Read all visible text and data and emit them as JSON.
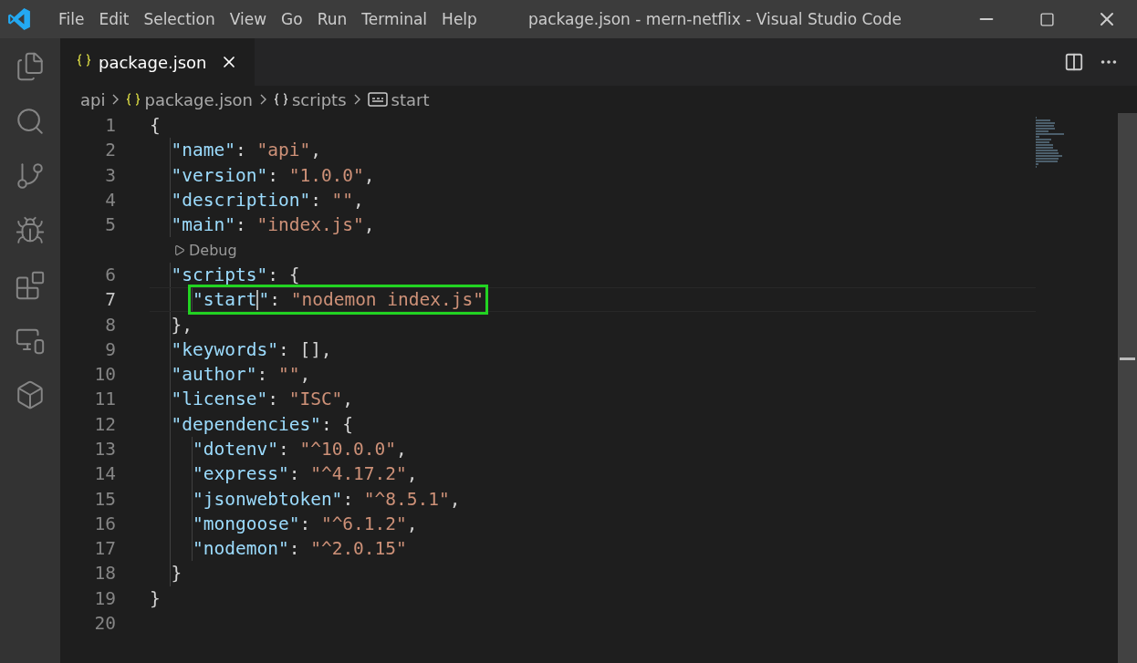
{
  "window": {
    "title": "package.json - mern-netflix - Visual Studio Code"
  },
  "menu": [
    "File",
    "Edit",
    "Selection",
    "View",
    "Go",
    "Run",
    "Terminal",
    "Help"
  ],
  "activity_bar": [
    {
      "kind": "files",
      "selected": false
    },
    {
      "kind": "search",
      "selected": false
    },
    {
      "kind": "source-control",
      "selected": false
    },
    {
      "kind": "run-debug",
      "selected": false
    },
    {
      "kind": "extensions",
      "selected": false
    },
    {
      "kind": "remote",
      "selected": false
    },
    {
      "kind": "containers",
      "selected": false
    }
  ],
  "tabs": [
    {
      "label": "package.json",
      "selected": true
    }
  ],
  "breadcrumbs": [
    {
      "kind": "folder",
      "label": "api"
    },
    {
      "kind": "json",
      "label": "package.json"
    },
    {
      "kind": "object",
      "label": "scripts"
    },
    {
      "kind": "string",
      "label": "start"
    }
  ],
  "lines": [
    {
      "kind": "code",
      "number": "1",
      "current": false,
      "highlighted": false,
      "tokens": [
        {
          "kind": "punct",
          "text": "{"
        }
      ]
    },
    {
      "kind": "code",
      "number": "2",
      "current": false,
      "highlighted": false,
      "tokens": [
        {
          "kind": "key",
          "text": "  \"name\""
        },
        {
          "kind": "punct",
          "text": ": "
        },
        {
          "kind": "string",
          "text": "\"api\""
        },
        {
          "kind": "punct",
          "text": ","
        }
      ]
    },
    {
      "kind": "code",
      "number": "3",
      "current": false,
      "highlighted": false,
      "tokens": [
        {
          "kind": "key",
          "text": "  \"version\""
        },
        {
          "kind": "punct",
          "text": ": "
        },
        {
          "kind": "string",
          "text": "\"1.0.0\""
        },
        {
          "kind": "punct",
          "text": ","
        }
      ]
    },
    {
      "kind": "code",
      "number": "4",
      "current": false,
      "highlighted": false,
      "tokens": [
        {
          "kind": "key",
          "text": "  \"description\""
        },
        {
          "kind": "punct",
          "text": ": "
        },
        {
          "kind": "string",
          "text": "\"\""
        },
        {
          "kind": "punct",
          "text": ","
        }
      ]
    },
    {
      "kind": "code",
      "number": "5",
      "current": false,
      "highlighted": false,
      "tokens": [
        {
          "kind": "key",
          "text": "  \"main\""
        },
        {
          "kind": "punct",
          "text": ": "
        },
        {
          "kind": "string",
          "text": "\"index.js\""
        },
        {
          "kind": "punct",
          "text": ","
        }
      ]
    },
    {
      "kind": "codelens",
      "text": "Debug"
    },
    {
      "kind": "code",
      "number": "6",
      "current": false,
      "highlighted": false,
      "tokens": [
        {
          "kind": "key",
          "text": "  \"scripts\""
        },
        {
          "kind": "punct",
          "text": ": {"
        }
      ]
    },
    {
      "kind": "code",
      "number": "7",
      "current": true,
      "highlighted": true,
      "tokens": [
        {
          "kind": "key",
          "text": "    \"start"
        },
        {
          "kind": "cursor"
        },
        {
          "kind": "key",
          "text": "\""
        },
        {
          "kind": "punct",
          "text": ": "
        },
        {
          "kind": "string",
          "text": "\"nodemon index.js\""
        }
      ]
    },
    {
      "kind": "code",
      "number": "8",
      "current": false,
      "highlighted": false,
      "tokens": [
        {
          "kind": "punct",
          "text": "  },"
        }
      ]
    },
    {
      "kind": "code",
      "number": "9",
      "current": false,
      "highlighted": false,
      "tokens": [
        {
          "kind": "key",
          "text": "  \"keywords\""
        },
        {
          "kind": "punct",
          "text": ": [],"
        }
      ]
    },
    {
      "kind": "code",
      "number": "10",
      "current": false,
      "highlighted": false,
      "tokens": [
        {
          "kind": "key",
          "text": "  \"author\""
        },
        {
          "kind": "punct",
          "text": ": "
        },
        {
          "kind": "string",
          "text": "\"\""
        },
        {
          "kind": "punct",
          "text": ","
        }
      ]
    },
    {
      "kind": "code",
      "number": "11",
      "current": false,
      "highlighted": false,
      "tokens": [
        {
          "kind": "key",
          "text": "  \"license\""
        },
        {
          "kind": "punct",
          "text": ": "
        },
        {
          "kind": "string",
          "text": "\"ISC\""
        },
        {
          "kind": "punct",
          "text": ","
        }
      ]
    },
    {
      "kind": "code",
      "number": "12",
      "current": false,
      "highlighted": false,
      "tokens": [
        {
          "kind": "key",
          "text": "  \"dependencies\""
        },
        {
          "kind": "punct",
          "text": ": {"
        }
      ]
    },
    {
      "kind": "code",
      "number": "13",
      "current": false,
      "highlighted": false,
      "tokens": [
        {
          "kind": "key",
          "text": "    \"dotenv\""
        },
        {
          "kind": "punct",
          "text": ": "
        },
        {
          "kind": "string",
          "text": "\"^10.0.0\""
        },
        {
          "kind": "punct",
          "text": ","
        }
      ]
    },
    {
      "kind": "code",
      "number": "14",
      "current": false,
      "highlighted": false,
      "tokens": [
        {
          "kind": "key",
          "text": "    \"express\""
        },
        {
          "kind": "punct",
          "text": ": "
        },
        {
          "kind": "string",
          "text": "\"^4.17.2\""
        },
        {
          "kind": "punct",
          "text": ","
        }
      ]
    },
    {
      "kind": "code",
      "number": "15",
      "current": false,
      "highlighted": false,
      "tokens": [
        {
          "kind": "key",
          "text": "    \"jsonwebtoken\""
        },
        {
          "kind": "punct",
          "text": ": "
        },
        {
          "kind": "string",
          "text": "\"^8.5.1\""
        },
        {
          "kind": "punct",
          "text": ","
        }
      ]
    },
    {
      "kind": "code",
      "number": "16",
      "current": false,
      "highlighted": false,
      "tokens": [
        {
          "kind": "key",
          "text": "    \"mongoose\""
        },
        {
          "kind": "punct",
          "text": ": "
        },
        {
          "kind": "string",
          "text": "\"^6.1.2\""
        },
        {
          "kind": "punct",
          "text": ","
        }
      ]
    },
    {
      "kind": "code",
      "number": "17",
      "current": false,
      "highlighted": false,
      "tokens": [
        {
          "kind": "key",
          "text": "    \"nodemon\""
        },
        {
          "kind": "punct",
          "text": ": "
        },
        {
          "kind": "string",
          "text": "\"^2.0.15\""
        }
      ]
    },
    {
      "kind": "code",
      "number": "18",
      "current": false,
      "highlighted": false,
      "tokens": [
        {
          "kind": "punct",
          "text": "  }"
        }
      ]
    },
    {
      "kind": "code",
      "number": "19",
      "current": false,
      "highlighted": false,
      "tokens": [
        {
          "kind": "punct",
          "text": "}"
        }
      ]
    },
    {
      "kind": "code",
      "number": "20",
      "current": false,
      "highlighted": false
    }
  ]
}
